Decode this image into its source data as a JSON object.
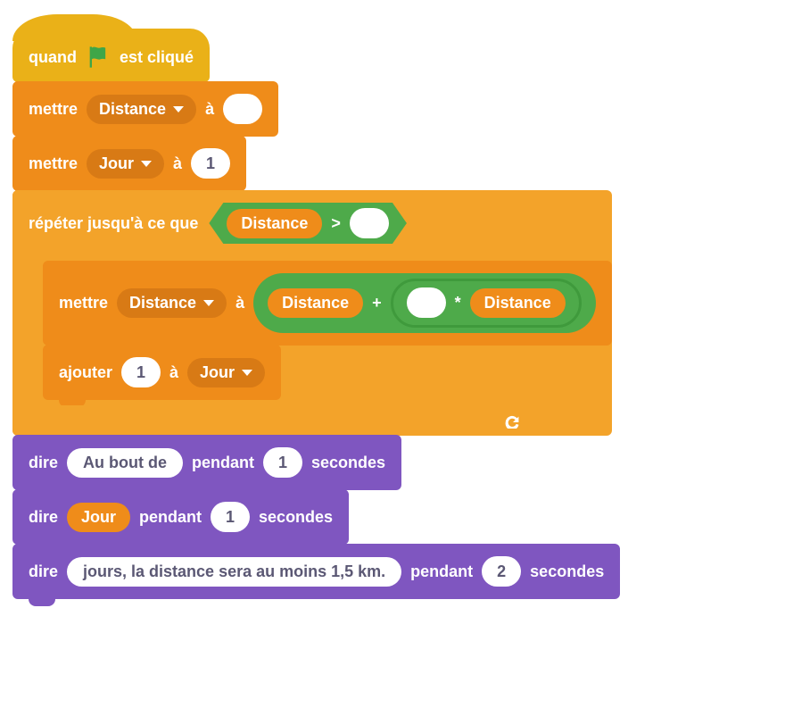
{
  "hat": {
    "prefix": "quand",
    "suffix": "est cliqué"
  },
  "set1": {
    "kw_set": "mettre",
    "var": "Distance",
    "kw_to": "à",
    "value": ""
  },
  "set2": {
    "kw_set": "mettre",
    "var": "Jour",
    "kw_to": "à",
    "value": "1"
  },
  "repeat": {
    "label": "répéter jusqu'à ce que",
    "cond": {
      "left_var": "Distance",
      "op": ">",
      "right_value": ""
    }
  },
  "set3": {
    "kw_set": "mettre",
    "var": "Distance",
    "kw_to": "à",
    "expr": {
      "left_var": "Distance",
      "op1": "+",
      "mid_value": "",
      "op2": "*",
      "right_var": "Distance"
    }
  },
  "change": {
    "kw_change": "ajouter",
    "value": "1",
    "kw_to": "à",
    "var": "Jour"
  },
  "say1": {
    "kw": "dire",
    "text": "Au bout de",
    "kw_for": "pendant",
    "secs": "1",
    "kw_secs": "secondes"
  },
  "say2": {
    "kw": "dire",
    "var": "Jour",
    "kw_for": "pendant",
    "secs": "1",
    "kw_secs": "secondes"
  },
  "say3": {
    "kw": "dire",
    "text": "jours, la distance sera au moins 1,5 km.",
    "kw_for": "pendant",
    "secs": "2",
    "kw_secs": "secondes"
  }
}
